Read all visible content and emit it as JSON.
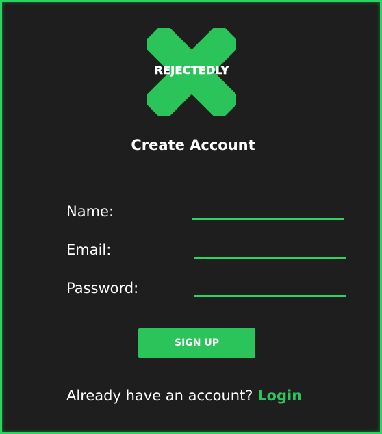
{
  "brand": {
    "name": "REJECTEDLY",
    "accent_color": "#2bc45a"
  },
  "page": {
    "title": "Create Account"
  },
  "form": {
    "name_label": "Name:",
    "name_value": "",
    "email_label": "Email:",
    "email_value": "",
    "password_label": "Password:",
    "password_value": ""
  },
  "actions": {
    "signup_label": "SIGN UP"
  },
  "footer": {
    "prompt": "Already have an account?",
    "login_label": "Login"
  },
  "icons": {
    "logo": "x-logo-icon"
  }
}
